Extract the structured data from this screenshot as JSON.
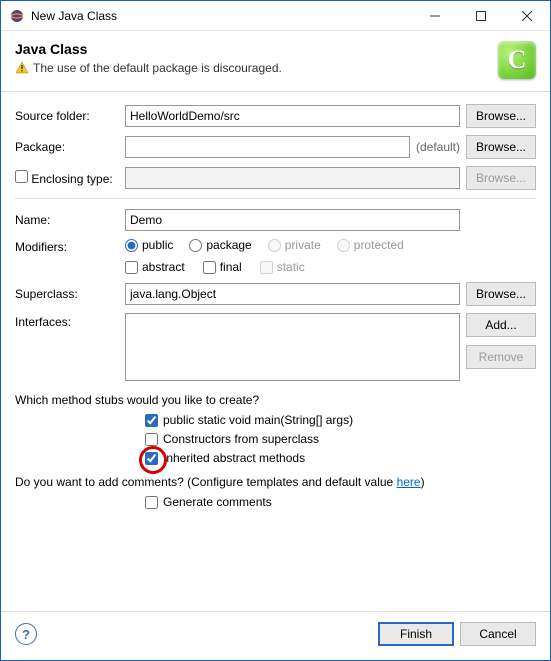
{
  "window": {
    "title": "New Java Class"
  },
  "banner": {
    "title": "Java Class",
    "warning": "The use of the default package is discouraged."
  },
  "labels": {
    "source_folder": "Source folder:",
    "package": "Package:",
    "enclosing_type": "Enclosing type:",
    "name": "Name:",
    "modifiers": "Modifiers:",
    "superclass": "Superclass:",
    "interfaces": "Interfaces:",
    "default": "(default)"
  },
  "values": {
    "source_folder": "HelloWorldDemo/src",
    "package": "",
    "enclosing_type": "",
    "name": "Demo",
    "superclass": "java.lang.Object"
  },
  "modifiers": {
    "radios": {
      "public": "public",
      "package": "package",
      "private": "private",
      "protected": "protected"
    },
    "checks": {
      "abstract": "abstract",
      "final": "final",
      "static": "static"
    }
  },
  "buttons": {
    "browse": "Browse...",
    "add": "Add...",
    "remove": "Remove",
    "finish": "Finish",
    "cancel": "Cancel"
  },
  "stubs": {
    "question": "Which method stubs would you like to create?",
    "main": "public static void main(String[] args)",
    "constructors": "Constructors from superclass",
    "inherited": "Inherited abstract methods"
  },
  "comments": {
    "question_prefix": "Do you want to add comments? (Configure templates and default value ",
    "here": "here",
    "question_suffix": ")",
    "generate": "Generate comments"
  }
}
